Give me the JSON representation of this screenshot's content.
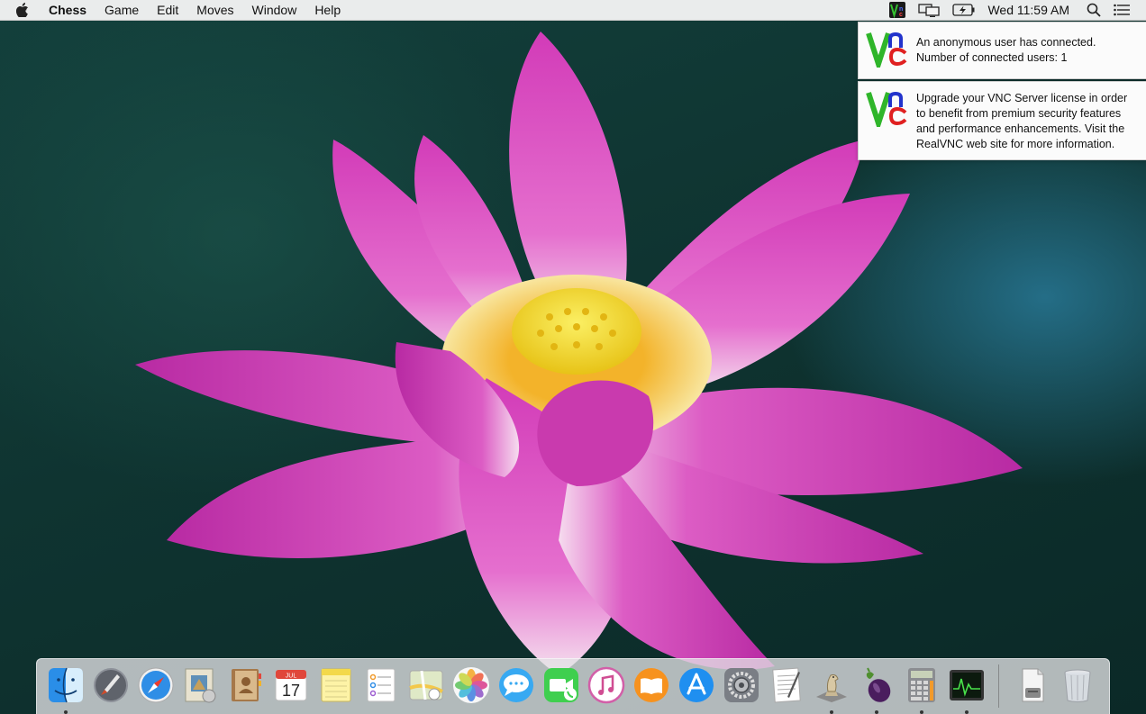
{
  "menubar": {
    "apple_icon": "apple-icon",
    "app_name": "Chess",
    "menus": [
      "Game",
      "Edit",
      "Moves",
      "Window",
      "Help"
    ],
    "status_icons": [
      "vnc-icon",
      "display-mirroring-icon",
      "battery-charging-icon",
      "search-icon",
      "notification-center-icon"
    ],
    "clock": "Wed 11:59 AM"
  },
  "notifications": [
    {
      "icon": "vnc-logo-icon",
      "line1": "An anonymous user has connected.",
      "line2": "Number of connected users: 1"
    },
    {
      "icon": "vnc-logo-icon",
      "line1": "Upgrade your VNC Server license in order",
      "line2": "to benefit from premium security features",
      "line3": "and performance enhancements. Visit the",
      "line4": "RealVNC web site for more information."
    }
  ],
  "colors": {
    "vnc_green": "#2fb52a",
    "vnc_blue": "#2233cc",
    "vnc_red": "#e02020",
    "petal_pink": "#d42fb6",
    "lotus_yellow": "#f6e23a"
  },
  "dock": {
    "apps": [
      {
        "name": "finder-icon",
        "running": true
      },
      {
        "name": "launchpad-icon",
        "running": false
      },
      {
        "name": "safari-icon",
        "running": false
      },
      {
        "name": "mail-icon",
        "running": false
      },
      {
        "name": "contacts-icon",
        "running": false
      },
      {
        "name": "calendar-icon",
        "running": false,
        "month": "JUL",
        "day": "17"
      },
      {
        "name": "notes-icon",
        "running": false
      },
      {
        "name": "reminders-icon",
        "running": false
      },
      {
        "name": "maps-icon",
        "running": false
      },
      {
        "name": "photos-icon",
        "running": false
      },
      {
        "name": "messages-icon",
        "running": false
      },
      {
        "name": "facetime-icon",
        "running": false
      },
      {
        "name": "itunes-icon",
        "running": false
      },
      {
        "name": "ibooks-icon",
        "running": false
      },
      {
        "name": "app-store-icon",
        "running": false
      },
      {
        "name": "system-preferences-icon",
        "running": false
      },
      {
        "name": "textedit-icon",
        "running": false
      },
      {
        "name": "chess-icon",
        "running": true
      },
      {
        "name": "eggplant-icon",
        "running": true
      },
      {
        "name": "calculator-icon",
        "running": true
      },
      {
        "name": "activity-monitor-icon",
        "running": true
      }
    ],
    "extras": [
      {
        "name": "downloads-stack-icon",
        "running": false
      },
      {
        "name": "trash-icon",
        "running": false
      }
    ]
  }
}
